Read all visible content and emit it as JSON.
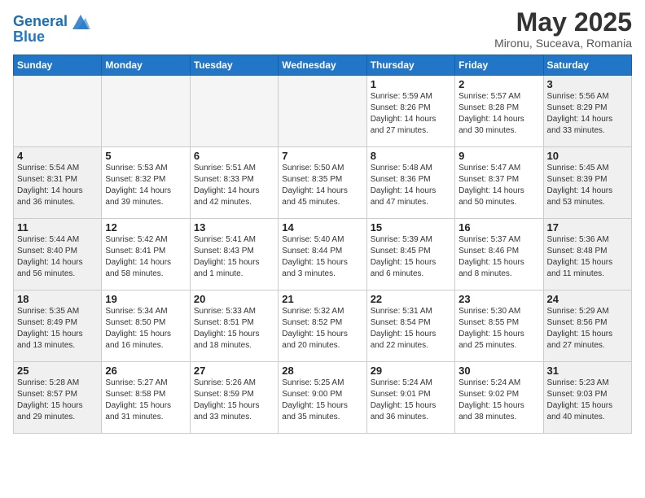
{
  "header": {
    "logo_line1": "General",
    "logo_line2": "Blue",
    "month_title": "May 2025",
    "location": "Mironu, Suceava, Romania"
  },
  "weekdays": [
    "Sunday",
    "Monday",
    "Tuesday",
    "Wednesday",
    "Thursday",
    "Friday",
    "Saturday"
  ],
  "weeks": [
    [
      {
        "day": "",
        "info": ""
      },
      {
        "day": "",
        "info": ""
      },
      {
        "day": "",
        "info": ""
      },
      {
        "day": "",
        "info": ""
      },
      {
        "day": "1",
        "info": "Sunrise: 5:59 AM\nSunset: 8:26 PM\nDaylight: 14 hours\nand 27 minutes."
      },
      {
        "day": "2",
        "info": "Sunrise: 5:57 AM\nSunset: 8:28 PM\nDaylight: 14 hours\nand 30 minutes."
      },
      {
        "day": "3",
        "info": "Sunrise: 5:56 AM\nSunset: 8:29 PM\nDaylight: 14 hours\nand 33 minutes."
      }
    ],
    [
      {
        "day": "4",
        "info": "Sunrise: 5:54 AM\nSunset: 8:31 PM\nDaylight: 14 hours\nand 36 minutes."
      },
      {
        "day": "5",
        "info": "Sunrise: 5:53 AM\nSunset: 8:32 PM\nDaylight: 14 hours\nand 39 minutes."
      },
      {
        "day": "6",
        "info": "Sunrise: 5:51 AM\nSunset: 8:33 PM\nDaylight: 14 hours\nand 42 minutes."
      },
      {
        "day": "7",
        "info": "Sunrise: 5:50 AM\nSunset: 8:35 PM\nDaylight: 14 hours\nand 45 minutes."
      },
      {
        "day": "8",
        "info": "Sunrise: 5:48 AM\nSunset: 8:36 PM\nDaylight: 14 hours\nand 47 minutes."
      },
      {
        "day": "9",
        "info": "Sunrise: 5:47 AM\nSunset: 8:37 PM\nDaylight: 14 hours\nand 50 minutes."
      },
      {
        "day": "10",
        "info": "Sunrise: 5:45 AM\nSunset: 8:39 PM\nDaylight: 14 hours\nand 53 minutes."
      }
    ],
    [
      {
        "day": "11",
        "info": "Sunrise: 5:44 AM\nSunset: 8:40 PM\nDaylight: 14 hours\nand 56 minutes."
      },
      {
        "day": "12",
        "info": "Sunrise: 5:42 AM\nSunset: 8:41 PM\nDaylight: 14 hours\nand 58 minutes."
      },
      {
        "day": "13",
        "info": "Sunrise: 5:41 AM\nSunset: 8:43 PM\nDaylight: 15 hours\nand 1 minute."
      },
      {
        "day": "14",
        "info": "Sunrise: 5:40 AM\nSunset: 8:44 PM\nDaylight: 15 hours\nand 3 minutes."
      },
      {
        "day": "15",
        "info": "Sunrise: 5:39 AM\nSunset: 8:45 PM\nDaylight: 15 hours\nand 6 minutes."
      },
      {
        "day": "16",
        "info": "Sunrise: 5:37 AM\nSunset: 8:46 PM\nDaylight: 15 hours\nand 8 minutes."
      },
      {
        "day": "17",
        "info": "Sunrise: 5:36 AM\nSunset: 8:48 PM\nDaylight: 15 hours\nand 11 minutes."
      }
    ],
    [
      {
        "day": "18",
        "info": "Sunrise: 5:35 AM\nSunset: 8:49 PM\nDaylight: 15 hours\nand 13 minutes."
      },
      {
        "day": "19",
        "info": "Sunrise: 5:34 AM\nSunset: 8:50 PM\nDaylight: 15 hours\nand 16 minutes."
      },
      {
        "day": "20",
        "info": "Sunrise: 5:33 AM\nSunset: 8:51 PM\nDaylight: 15 hours\nand 18 minutes."
      },
      {
        "day": "21",
        "info": "Sunrise: 5:32 AM\nSunset: 8:52 PM\nDaylight: 15 hours\nand 20 minutes."
      },
      {
        "day": "22",
        "info": "Sunrise: 5:31 AM\nSunset: 8:54 PM\nDaylight: 15 hours\nand 22 minutes."
      },
      {
        "day": "23",
        "info": "Sunrise: 5:30 AM\nSunset: 8:55 PM\nDaylight: 15 hours\nand 25 minutes."
      },
      {
        "day": "24",
        "info": "Sunrise: 5:29 AM\nSunset: 8:56 PM\nDaylight: 15 hours\nand 27 minutes."
      }
    ],
    [
      {
        "day": "25",
        "info": "Sunrise: 5:28 AM\nSunset: 8:57 PM\nDaylight: 15 hours\nand 29 minutes."
      },
      {
        "day": "26",
        "info": "Sunrise: 5:27 AM\nSunset: 8:58 PM\nDaylight: 15 hours\nand 31 minutes."
      },
      {
        "day": "27",
        "info": "Sunrise: 5:26 AM\nSunset: 8:59 PM\nDaylight: 15 hours\nand 33 minutes."
      },
      {
        "day": "28",
        "info": "Sunrise: 5:25 AM\nSunset: 9:00 PM\nDaylight: 15 hours\nand 35 minutes."
      },
      {
        "day": "29",
        "info": "Sunrise: 5:24 AM\nSunset: 9:01 PM\nDaylight: 15 hours\nand 36 minutes."
      },
      {
        "day": "30",
        "info": "Sunrise: 5:24 AM\nSunset: 9:02 PM\nDaylight: 15 hours\nand 38 minutes."
      },
      {
        "day": "31",
        "info": "Sunrise: 5:23 AM\nSunset: 9:03 PM\nDaylight: 15 hours\nand 40 minutes."
      }
    ]
  ]
}
